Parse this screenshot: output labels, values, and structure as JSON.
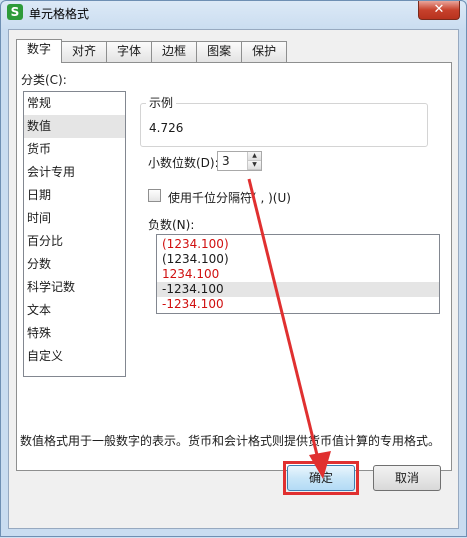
{
  "window": {
    "title": "单元格格式",
    "close_glyph": "✕",
    "app_icon_glyph": "S"
  },
  "tabs": [
    {
      "label": "数字",
      "active": true
    },
    {
      "label": "对齐"
    },
    {
      "label": "字体"
    },
    {
      "label": "边框"
    },
    {
      "label": "图案"
    },
    {
      "label": "保护"
    }
  ],
  "category": {
    "label": "分类(C):",
    "items": [
      "常规",
      "数值",
      "货币",
      "会计专用",
      "日期",
      "时间",
      "百分比",
      "分数",
      "科学记数",
      "文本",
      "特殊",
      "自定义"
    ],
    "selected_index": 1
  },
  "sample": {
    "legend": "示例",
    "value": "4.726"
  },
  "decimal": {
    "label": "小数位数(D):",
    "value": "3"
  },
  "thousands": {
    "label": "使用千位分隔符( , )(U)",
    "checked": false
  },
  "negative": {
    "label": "负数(N):",
    "items": [
      {
        "text": "(1234.100)",
        "red": true
      },
      {
        "text": "(1234.100)",
        "red": false
      },
      {
        "text": "1234.100",
        "red": true
      },
      {
        "text": "-1234.100",
        "red": false,
        "selected": true
      },
      {
        "text": "-1234.100",
        "red": true
      }
    ]
  },
  "description": "数值格式用于一般数字的表示。货币和会计格式则提供货币值计算的专用格式。",
  "buttons": {
    "ok": "确定",
    "cancel": "取消"
  },
  "colors": {
    "annotation": "#e03030",
    "negative_red": "#d01010"
  }
}
